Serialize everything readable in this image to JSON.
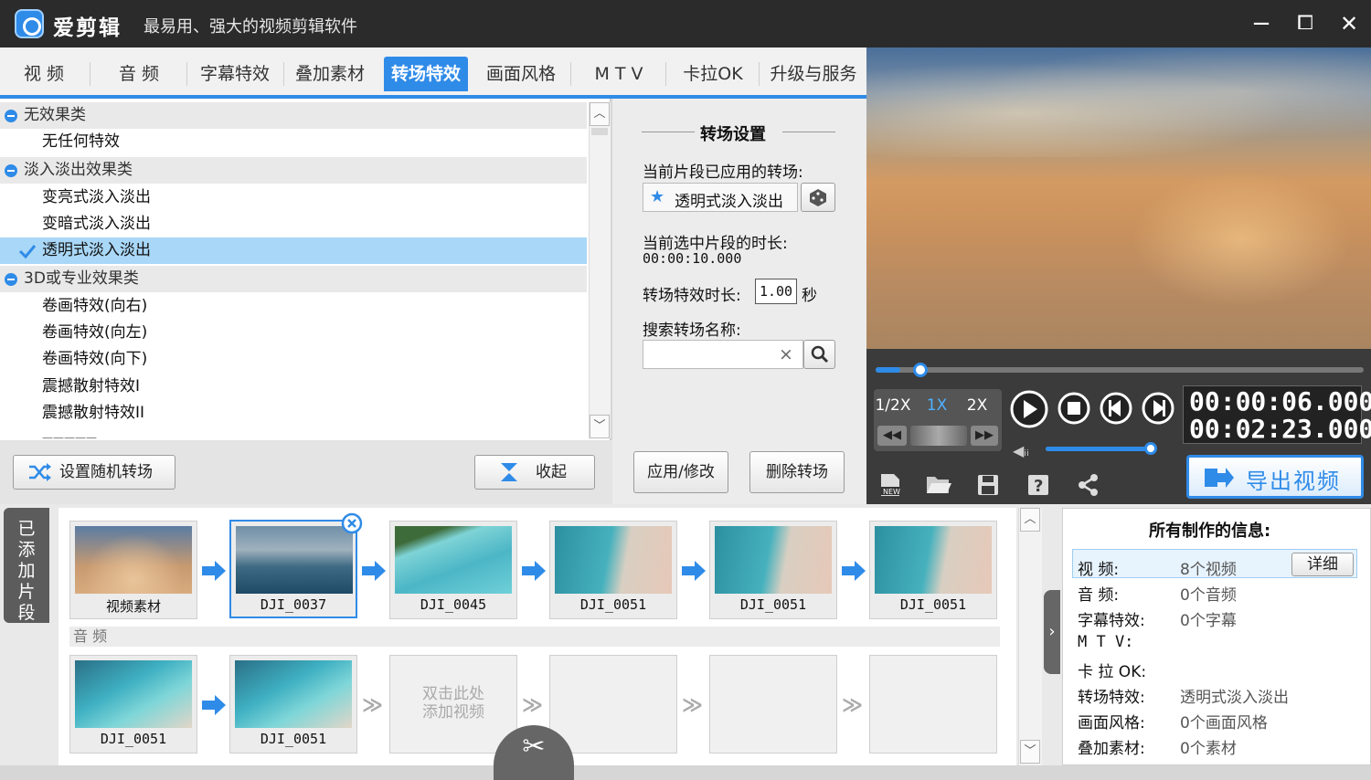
{
  "window": {
    "title": "爱剪辑",
    "subtitle": "最易用、强大的视频剪辑软件",
    "minimize": "−",
    "maximize": "⧠",
    "close": "✕"
  },
  "tabs": [
    "视 频",
    "音 频",
    "字幕特效",
    "叠加素材",
    "转场特效",
    "画面风格",
    "M T V",
    "卡拉OK",
    "升级与服务"
  ],
  "active_tab": "转场特效",
  "effect_list": [
    {
      "type": "category",
      "label": "无效果类"
    },
    {
      "type": "item",
      "label": "无任何特效"
    },
    {
      "type": "category",
      "label": "淡入淡出效果类"
    },
    {
      "type": "item",
      "label": "变亮式淡入淡出"
    },
    {
      "type": "item",
      "label": "变暗式淡入淡出"
    },
    {
      "type": "item",
      "label": "透明式淡入淡出",
      "selected": true
    },
    {
      "type": "category",
      "label": "3D或专业效果类"
    },
    {
      "type": "item",
      "label": "卷画特效(向右)"
    },
    {
      "type": "item",
      "label": "卷画特效(向左)"
    },
    {
      "type": "item",
      "label": "卷画特效(向下)"
    },
    {
      "type": "item",
      "label": "震撼散射特效I"
    },
    {
      "type": "item",
      "label": "震撼散射特效II"
    }
  ],
  "settings": {
    "heading": "转场设置",
    "applied_label": "当前片段已应用的转场:",
    "applied_value": "透明式淡入淡出",
    "duration_label": "当前选中片段的时长:",
    "duration_value": "00:00:10.000",
    "effect_duration_label": "转场特效时长:",
    "effect_duration_value": "1.00",
    "effect_duration_unit": "秒",
    "search_label": "搜索转场名称:",
    "search_value": "",
    "clear_icon": "×",
    "apply_button": "应用/修改",
    "delete_button": "删除转场"
  },
  "left_buttons": {
    "random": "设置随机转场",
    "collapse": "收起"
  },
  "player": {
    "speeds": [
      "1/2X",
      "1X",
      "2X"
    ],
    "active_speed": "1X",
    "current_time": "00:00:06.000",
    "total_time": "00:02:23.000",
    "progress": 0.05,
    "volume": 1.0,
    "export_button": "导出视频"
  },
  "added_clips_tab": "已添加片段",
  "video_clips": [
    {
      "name": "视频素材",
      "scene": "clouds"
    },
    {
      "name": "DJI_0037",
      "scene": "ocean",
      "selected": true
    },
    {
      "name": "DJI_0045",
      "scene": "shore"
    },
    {
      "name": "DJI_0051",
      "scene": "beach"
    },
    {
      "name": "DJI_0051",
      "scene": "beach"
    },
    {
      "name": "DJI_0051",
      "scene": "beach"
    }
  ],
  "audio_label": "音 频",
  "second_row_clips": [
    {
      "name": "DJI_0051",
      "scene": "lagoon"
    },
    {
      "name": "DJI_0051",
      "scene": "lagoon"
    }
  ],
  "add_placeholder": "双击此处\n添加视频",
  "info": {
    "title": "所有制作的信息:",
    "detail_button": "详细",
    "rows": [
      {
        "key": "视    频:",
        "value": "8个视频"
      },
      {
        "key": "音    频:",
        "value": "0个音频"
      },
      {
        "key": "字幕特效:",
        "value": "0个字幕"
      },
      {
        "key": "M  T  V:",
        "value": ""
      },
      {
        "key": "卡 拉 OK:",
        "value": ""
      },
      {
        "key": "转场特效:",
        "value": "透明式淡入淡出"
      },
      {
        "key": "画面风格:",
        "value": "0个画面风格"
      },
      {
        "key": "叠加素材:",
        "value": "0个素材"
      }
    ]
  },
  "colors": {
    "accent": "#2f8be8",
    "selection": "#a9d7f7",
    "titlebar": "#2b2b2b"
  }
}
